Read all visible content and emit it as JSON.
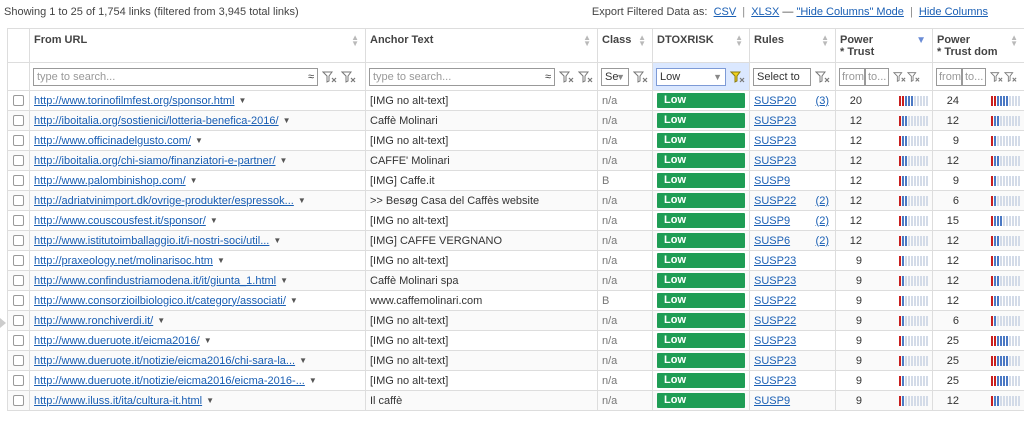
{
  "summary": "Showing 1 to 25 of 1,754 links (filtered from 3,945 total links)",
  "export": {
    "label": "Export Filtered Data as:",
    "csv": "CSV",
    "xlsx": "XLSX",
    "dash": "—",
    "hide_mode": "\"Hide Columns\" Mode",
    "hide_columns": "Hide Columns"
  },
  "columns": {
    "from_url": "From URL",
    "anchor": "Anchor Text",
    "class": "Class",
    "dtoxrisk": "DTOXRISK",
    "rules": "Rules",
    "power_trust_l1": "Power",
    "power_trust_l2": "* Trust",
    "power_trust_dom_l1": "Power",
    "power_trust_dom_l2": "* Trust dom"
  },
  "filters": {
    "from_url_placeholder": "type to search...",
    "anchor_placeholder": "type to search...",
    "class_value": "Se",
    "dtox_value": "Low",
    "rules_value": "Select to",
    "from_placeholder": "from",
    "to_placeholder": "to..."
  },
  "colors": {
    "risk_low": "#1f9d55",
    "link": "#1a5fb4",
    "bar_red": "#c81e1e",
    "bar_blue": "#4a78c4"
  },
  "rows": [
    {
      "url": "http://www.torinofilmfest.org/sponsor.html",
      "anchor": "[IMG no alt-text]",
      "cls": "n/a",
      "risk": "Low",
      "rule": "SUSP20",
      "count": "(3)",
      "p1": "20",
      "p1r": 2,
      "p1b": 3,
      "p2": "24",
      "p2r": 2,
      "p2b": 4
    },
    {
      "url": "http://iboitalia.org/sostienici/lotteria-benefica-2016/",
      "anchor": "Caffè Molinari",
      "cls": "n/a",
      "risk": "Low",
      "rule": "SUSP23",
      "count": "",
      "p1": "12",
      "p1r": 1,
      "p1b": 2,
      "p2": "12",
      "p2r": 1,
      "p2b": 2
    },
    {
      "url": "http://www.officinadelgusto.com/",
      "anchor": "[IMG no alt-text]",
      "cls": "n/a",
      "risk": "Low",
      "rule": "SUSP23",
      "count": "",
      "p1": "12",
      "p1r": 1,
      "p1b": 2,
      "p2": "9",
      "p2r": 1,
      "p2b": 1
    },
    {
      "url": "http://iboitalia.org/chi-siamo/finanziatori-e-partner/",
      "anchor": "CAFFE' Molinari",
      "cls": "n/a",
      "risk": "Low",
      "rule": "SUSP23",
      "count": "",
      "p1": "12",
      "p1r": 1,
      "p1b": 2,
      "p2": "12",
      "p2r": 1,
      "p2b": 2
    },
    {
      "url": "http://www.palombinishop.com/",
      "anchor": "[IMG] Caffe.it",
      "cls": "B",
      "risk": "Low",
      "rule": "SUSP9",
      "count": "",
      "p1": "12",
      "p1r": 1,
      "p1b": 2,
      "p2": "9",
      "p2r": 1,
      "p2b": 1
    },
    {
      "url": "http://adriatvinimport.dk/ovrige-produkter/espressok...",
      "anchor": ">> Besøg Casa del Caffès website",
      "cls": "n/a",
      "risk": "Low",
      "rule": "SUSP22",
      "count": "(2)",
      "p1": "12",
      "p1r": 1,
      "p1b": 2,
      "p2": "6",
      "p2r": 1,
      "p2b": 1
    },
    {
      "url": "http://www.couscousfest.it/sponsor/",
      "anchor": "[IMG no alt-text]",
      "cls": "n/a",
      "risk": "Low",
      "rule": "SUSP9",
      "count": "(2)",
      "p1": "12",
      "p1r": 1,
      "p1b": 2,
      "p2": "15",
      "p2r": 1,
      "p2b": 3
    },
    {
      "url": "http://www.istitutoimballaggio.it/i-nostri-soci/util...",
      "anchor": "[IMG] CAFFE VERGNANO",
      "cls": "n/a",
      "risk": "Low",
      "rule": "SUSP6",
      "count": "(2)",
      "p1": "12",
      "p1r": 1,
      "p1b": 2,
      "p2": "12",
      "p2r": 1,
      "p2b": 2
    },
    {
      "url": "http://praxeology.net/molinarisoc.htm",
      "anchor": "[IMG no alt-text]",
      "cls": "n/a",
      "risk": "Low",
      "rule": "SUSP23",
      "count": "",
      "p1": "9",
      "p1r": 1,
      "p1b": 1,
      "p2": "12",
      "p2r": 1,
      "p2b": 2
    },
    {
      "url": "http://www.confindustriamodena.it/it/giunta_1.html",
      "anchor": "Caffè Molinari spa",
      "cls": "n/a",
      "risk": "Low",
      "rule": "SUSP23",
      "count": "",
      "p1": "9",
      "p1r": 1,
      "p1b": 1,
      "p2": "12",
      "p2r": 1,
      "p2b": 2
    },
    {
      "url": "http://www.consorzioilbiologico.it/category/associati/",
      "anchor": "www.caffemolinari.com",
      "cls": "B",
      "risk": "Low",
      "rule": "SUSP22",
      "count": "",
      "p1": "9",
      "p1r": 1,
      "p1b": 1,
      "p2": "12",
      "p2r": 1,
      "p2b": 2
    },
    {
      "url": "http://www.ronchiverdi.it/",
      "anchor": "[IMG no alt-text]",
      "cls": "n/a",
      "risk": "Low",
      "rule": "SUSP22",
      "count": "",
      "p1": "9",
      "p1r": 1,
      "p1b": 1,
      "p2": "6",
      "p2r": 1,
      "p2b": 1
    },
    {
      "url": "http://www.dueruote.it/eicma2016/",
      "anchor": "[IMG no alt-text]",
      "cls": "n/a",
      "risk": "Low",
      "rule": "SUSP23",
      "count": "",
      "p1": "9",
      "p1r": 1,
      "p1b": 1,
      "p2": "25",
      "p2r": 2,
      "p2b": 4
    },
    {
      "url": "http://www.dueruote.it/notizie/eicma2016/chi-sara-la...",
      "anchor": "[IMG no alt-text]",
      "cls": "n/a",
      "risk": "Low",
      "rule": "SUSP23",
      "count": "",
      "p1": "9",
      "p1r": 1,
      "p1b": 1,
      "p2": "25",
      "p2r": 2,
      "p2b": 4
    },
    {
      "url": "http://www.dueruote.it/notizie/eicma2016/eicma-2016-...",
      "anchor": "[IMG no alt-text]",
      "cls": "n/a",
      "risk": "Low",
      "rule": "SUSP23",
      "count": "",
      "p1": "9",
      "p1r": 1,
      "p1b": 1,
      "p2": "25",
      "p2r": 2,
      "p2b": 4
    },
    {
      "url": "http://www.iluss.it/ita/cultura-it.html",
      "anchor": "Il caffè",
      "cls": "n/a",
      "risk": "Low",
      "rule": "SUSP9",
      "count": "",
      "p1": "9",
      "p1r": 1,
      "p1b": 1,
      "p2": "12",
      "p2r": 1,
      "p2b": 2
    }
  ]
}
